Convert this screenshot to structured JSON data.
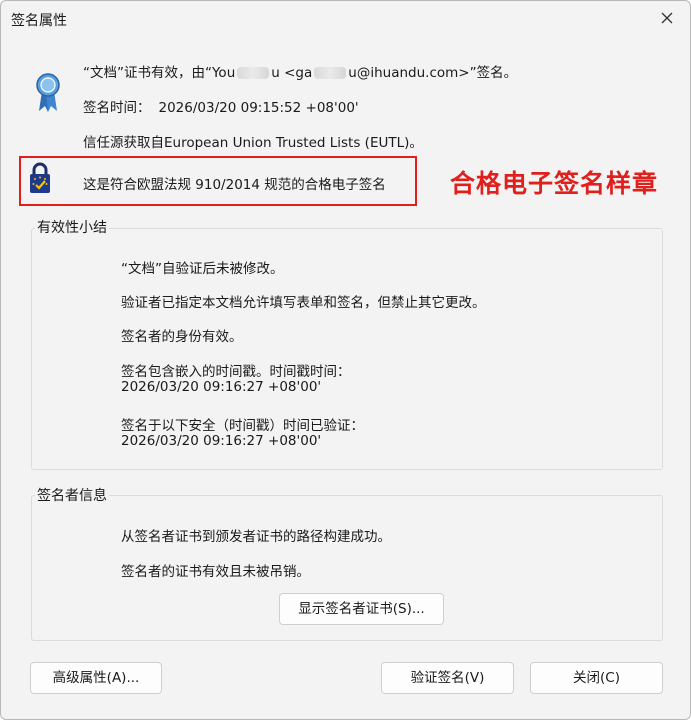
{
  "window": {
    "title": "签名属性"
  },
  "header": {
    "line1_prefix": "“文档”证书有效，由“You",
    "line1_blur1": "xxxxx",
    "line1_mid": "u <ga",
    "line1_blur2": "xxxx",
    "line1_suffix": "u@ihuandu.com>”签名。",
    "time_label": "签名时间：",
    "time_value": "2026/03/20 09:15:52 +08'00'",
    "trust_source": "信任源获取自European Union Trusted Lists (EUTL)。",
    "qualified_text": "这是符合欧盟法规 910/2014 规范的合格电子签名"
  },
  "annotation": {
    "label": "合格电子签名样章",
    "color": "#e0201c"
  },
  "validity": {
    "title": "有效性小结",
    "not_modified": "“文档”自验证后未被修改。",
    "permissions": "验证者已指定本文档允许填写表单和签名，但禁止其它更改。",
    "identity_valid": "签名者的身份有效。",
    "timestamp_label": "签名包含嵌入的时间戳。时间戳时间：",
    "timestamp_value": "2026/03/20 09:16:27 +08'00'",
    "verified_label": "签名于以下安全（时间戳）时间已验证：",
    "verified_value": "2026/03/20 09:16:27 +08'00'"
  },
  "signer": {
    "title": "签名者信息",
    "chain_ok": "从签名者证书到颁发者证书的路径构建成功。",
    "not_revoked": "签名者的证书有效且未被吊销。",
    "show_cert_button": "显示签名者证书(S)..."
  },
  "footer": {
    "advanced_button": "高级属性(A)...",
    "validate_button": "验证签名(V)",
    "close_button": "关闭(C)"
  }
}
